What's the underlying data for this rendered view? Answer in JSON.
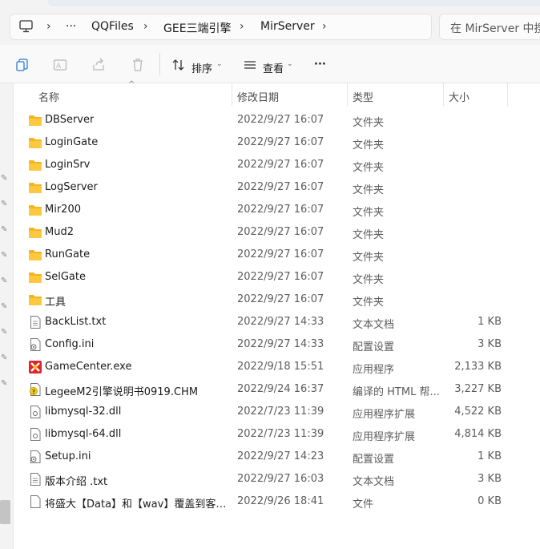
{
  "breadcrumb": {
    "items": [
      "QQFiles",
      "GEE三端引擎",
      "MirServer"
    ],
    "more": "···"
  },
  "search": {
    "placeholder": "在 MirServer 中搜索"
  },
  "toolbar": {
    "sort_label": "排序",
    "view_label": "查看",
    "more_label": "···"
  },
  "columns": {
    "name": "名称",
    "date": "修改日期",
    "type": "类型",
    "size": "大小"
  },
  "files": [
    {
      "name": "DBServer",
      "date": "2022/9/27 16:07",
      "type": "文件夹",
      "size": "",
      "icon": "folder-icon"
    },
    {
      "name": "LoginGate",
      "date": "2022/9/27 16:07",
      "type": "文件夹",
      "size": "",
      "icon": "folder-icon"
    },
    {
      "name": "LoginSrv",
      "date": "2022/9/27 16:07",
      "type": "文件夹",
      "size": "",
      "icon": "folder-icon"
    },
    {
      "name": "LogServer",
      "date": "2022/9/27 16:07",
      "type": "文件夹",
      "size": "",
      "icon": "folder-icon"
    },
    {
      "name": "Mir200",
      "date": "2022/9/27 16:07",
      "type": "文件夹",
      "size": "",
      "icon": "folder-icon"
    },
    {
      "name": "Mud2",
      "date": "2022/9/27 16:07",
      "type": "文件夹",
      "size": "",
      "icon": "folder-icon"
    },
    {
      "name": "RunGate",
      "date": "2022/9/27 16:07",
      "type": "文件夹",
      "size": "",
      "icon": "folder-icon"
    },
    {
      "name": "SelGate",
      "date": "2022/9/27 16:07",
      "type": "文件夹",
      "size": "",
      "icon": "folder-icon"
    },
    {
      "name": "工具",
      "date": "2022/9/27 16:07",
      "type": "文件夹",
      "size": "",
      "icon": "folder-icon"
    },
    {
      "name": "BackList.txt",
      "date": "2022/9/27 14:33",
      "type": "文本文档",
      "size": "1 KB",
      "icon": "text-file-icon"
    },
    {
      "name": "Config.ini",
      "date": "2022/9/27 14:33",
      "type": "配置设置",
      "size": "3 KB",
      "icon": "config-file-icon"
    },
    {
      "name": "GameCenter.exe",
      "date": "2022/9/18 15:51",
      "type": "应用程序",
      "size": "2,133 KB",
      "icon": "app-exe-icon"
    },
    {
      "name": "LegeeM2引擎说明书0919.CHM",
      "date": "2022/9/24 16:37",
      "type": "编译的 HTML 帮...",
      "size": "3,227 KB",
      "icon": "help-file-icon"
    },
    {
      "name": "libmysql-32.dll",
      "date": "2022/7/23 11:39",
      "type": "应用程序扩展",
      "size": "4,522 KB",
      "icon": "dll-file-icon"
    },
    {
      "name": "libmysql-64.dll",
      "date": "2022/7/23 11:39",
      "type": "应用程序扩展",
      "size": "4,814 KB",
      "icon": "dll-file-icon"
    },
    {
      "name": "Setup.ini",
      "date": "2022/9/27 14:23",
      "type": "配置设置",
      "size": "1 KB",
      "icon": "config-file-icon"
    },
    {
      "name": "版本介绍  .txt",
      "date": "2022/9/27 16:03",
      "type": "文本文档",
      "size": "3 KB",
      "icon": "text-file-icon"
    },
    {
      "name": "将盛大【Data】和【wav】覆盖到客户端...",
      "date": "2022/9/26 18:41",
      "type": "文件",
      "size": "0 KB",
      "icon": "blank-file-icon"
    }
  ]
}
